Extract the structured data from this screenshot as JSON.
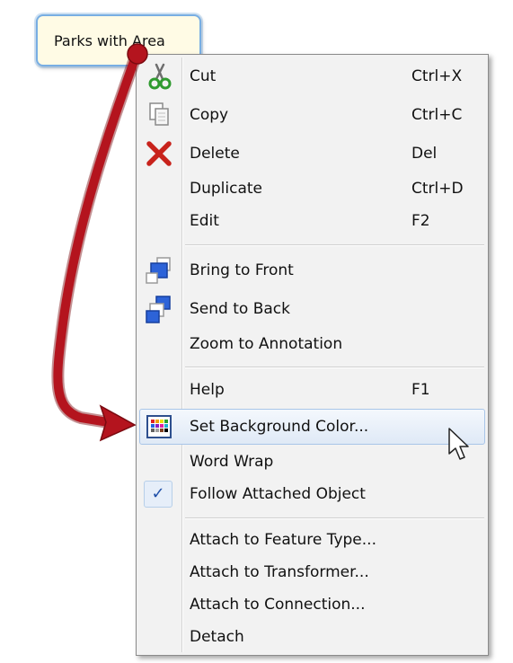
{
  "annotation": {
    "label": "Parks with Area"
  },
  "context_menu": {
    "items": [
      {
        "label": "Cut",
        "shortcut": "Ctrl+X",
        "icon": "scissors-icon"
      },
      {
        "label": "Copy",
        "shortcut": "Ctrl+C",
        "icon": "copy-icon"
      },
      {
        "label": "Delete",
        "shortcut": "Del",
        "icon": "red-x-delete-icon"
      },
      {
        "label": "Duplicate",
        "shortcut": "Ctrl+D"
      },
      {
        "label": "Edit",
        "shortcut": "F2"
      },
      {
        "label": "Bring to Front",
        "icon": "bring-to-front-icon"
      },
      {
        "label": "Send to Back",
        "icon": "send-to-back-icon"
      },
      {
        "label": "Zoom to Annotation"
      },
      {
        "label": "Help",
        "shortcut": "F1"
      },
      {
        "label": "Set Background Color...",
        "icon": "color-palette-icon",
        "highlighted": true
      },
      {
        "label": "Word Wrap"
      },
      {
        "label": "Follow Attached Object",
        "checked": true,
        "icon": "checkmark-icon"
      },
      {
        "label": "Attach to Feature Type..."
      },
      {
        "label": "Attach to Transformer..."
      },
      {
        "label": "Attach to Connection..."
      },
      {
        "label": "Detach"
      }
    ]
  },
  "colors": {
    "arrow": "#b4141e",
    "highlight_border": "#a8c5e8",
    "annotation_border": "#78aee3",
    "annotation_fill": "#fffbe5"
  }
}
